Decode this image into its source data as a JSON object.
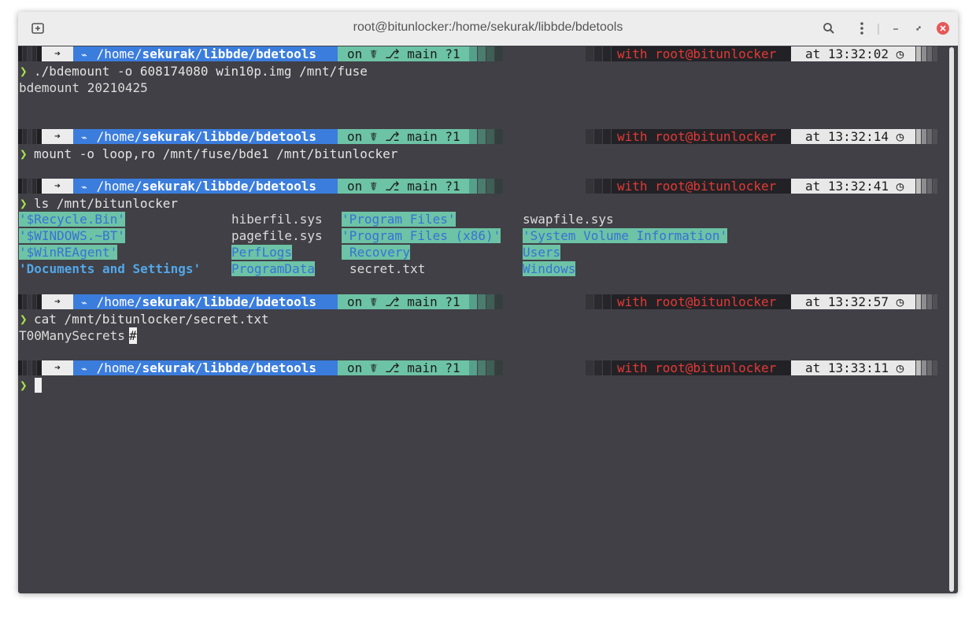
{
  "window": {
    "title": "root@bitunlocker:/home/sekurak/libbde/bdetools"
  },
  "prompt": {
    "path_prefix": "/home/",
    "path_user": "sekurak",
    "path_sep": "/",
    "path_repo": "libbde",
    "path_dir": "/bdetools",
    "git": "on ☤ ⎇ main ?1",
    "with": "with root@bitunlocker",
    "colors": {
      "path_bg": "#3b7ddd",
      "git_bg": "#6dc3a5",
      "with_fg": "#e53935",
      "time_bg": "#e8e8e8"
    }
  },
  "blocks": [
    {
      "time": "at 13:32:02 ◷",
      "cmd": "./bdemount -o 608174080 win10p.img /mnt/fuse",
      "output": [
        "bdemount 20210425"
      ]
    },
    {
      "time": "at 13:32:14 ◷",
      "cmd": "mount -o loop,ro /mnt/fuse/bde1 /mnt/bitunlocker",
      "output": []
    },
    {
      "time": "at 13:32:41 ◷",
      "cmd": "ls /mnt/bitunlocker"
    },
    {
      "time": "at 13:32:57 ◷",
      "cmd": "cat /mnt/bitunlocker/secret.txt",
      "output": [
        "T00ManySecrets"
      ],
      "output_suffix": "#"
    },
    {
      "time": "at 13:33:11 ◷",
      "cmd": ""
    }
  ],
  "ls_listing": {
    "col1": [
      "'$Recycle.Bin'",
      "'$WINDOWS.~BT'",
      "'$WinREAgent'",
      "'Documents and Settings'"
    ],
    "col2": [
      "hiberfil.sys",
      "pagefile.sys",
      "PerfLogs",
      "ProgramData"
    ],
    "col3": [
      "'Program Files'",
      "'Program Files (x86)'",
      "Recovery",
      "secret.txt"
    ],
    "col4": [
      "swapfile.sys",
      "'System Volume Information'",
      "Users",
      "Windows"
    ]
  }
}
